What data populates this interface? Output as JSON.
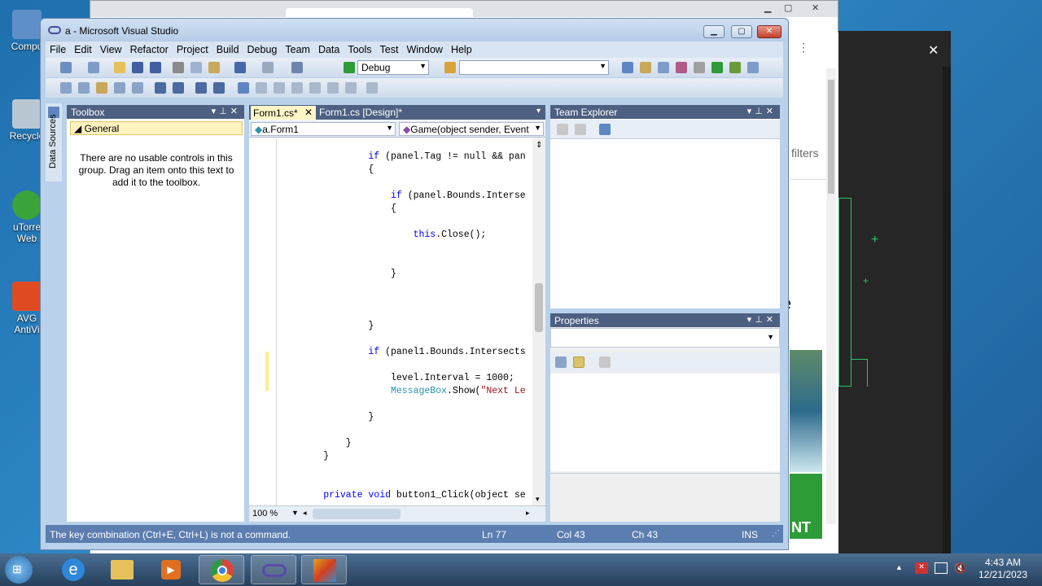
{
  "desktop": {
    "icons": [
      {
        "label": "Compu",
        "color": "#5f8fc9"
      },
      {
        "label": "Recycle",
        "color": "#b9c7d4"
      },
      {
        "label": "uTorre Web",
        "color": "#3aa33a"
      },
      {
        "label": "AVG AntiVi",
        "color": "#e04a20"
      }
    ]
  },
  "background_window": {
    "filters_text": "filters",
    "side_letter": "e",
    "side_text": "NT"
  },
  "vs": {
    "title": "a - Microsoft Visual Studio",
    "menu": [
      "File",
      "Edit",
      "View",
      "Refactor",
      "Project",
      "Build",
      "Debug",
      "Team",
      "Data",
      "Tools",
      "Test",
      "Window",
      "Help"
    ],
    "config_combo": "Debug",
    "platform_combo": "",
    "data_sources_label": "Data Sources",
    "toolbox": {
      "title": "Toolbox",
      "group": "General",
      "message": "There are no usable controls in this group. Drag an item onto this text to add it to the toolbox."
    },
    "tabs": [
      {
        "label": "Form1.cs*",
        "active": true
      },
      {
        "label": "Form1.cs [Design]*",
        "active": false
      }
    ],
    "class_combo": "a.Form1",
    "member_combo": "Game(object sender, Event",
    "code_lines": [
      {
        "indent": 16,
        "text": "if (panel.Tag != null && pan",
        "kw": "if"
      },
      {
        "indent": 16,
        "text": "{"
      },
      {
        "indent": 20,
        "text": "if (panel.Bounds.Interse",
        "kw": "if"
      },
      {
        "indent": 20,
        "text": "{"
      },
      {
        "indent": 24,
        "text": "this.Close();",
        "kw": "this"
      },
      {
        "indent": 20,
        "text": "}"
      },
      {
        "indent": 16,
        "text": "}"
      },
      {
        "indent": 16,
        "text": "if (panel1.Bounds.Intersects",
        "kw": "if"
      },
      {
        "indent": 20,
        "text": "level.Interval = 1000;"
      },
      {
        "indent": 20,
        "text": "MessageBox.Show(\"Next Le",
        "ty": "MessageBox"
      },
      {
        "indent": 16,
        "text": "}"
      },
      {
        "indent": 12,
        "text": "}"
      },
      {
        "indent": 8,
        "text": "}"
      },
      {
        "indent": 8,
        "text": "private void button1_Click(object se",
        "kw": "private void"
      }
    ],
    "zoom": "100 %",
    "team_explorer": {
      "title": "Team Explorer"
    },
    "properties": {
      "title": "Properties"
    },
    "status": {
      "message": "The key combination (Ctrl+E, Ctrl+L) is not a command.",
      "line": "Ln 77",
      "col": "Col 43",
      "ch": "Ch 43",
      "mode": "INS"
    }
  },
  "taskbar": {
    "apps": [
      {
        "name": "start-button",
        "color": "#3f8fd6"
      },
      {
        "name": "internet-explorer",
        "color": "#2f87d9"
      },
      {
        "name": "file-explorer",
        "color": "#e6c05a"
      },
      {
        "name": "media-player",
        "color": "#e07020"
      },
      {
        "name": "chrome",
        "color": "#d9453a"
      },
      {
        "name": "visual-studio",
        "color": "#5a4aa8"
      },
      {
        "name": "app",
        "color": "#e0a020"
      }
    ],
    "time": "4:43 AM",
    "date": "12/21/2023"
  }
}
